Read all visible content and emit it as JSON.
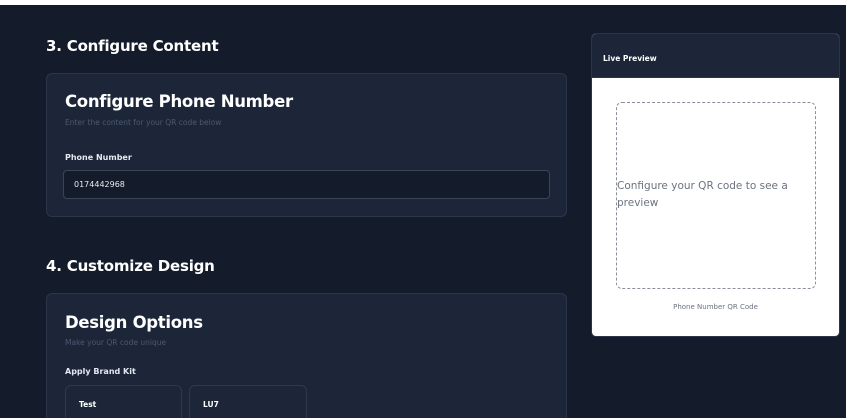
{
  "sections": {
    "content_title": "3. Configure Content",
    "design_title": "4. Customize Design"
  },
  "content_card": {
    "title": "Configure Phone Number",
    "subtitle": "Enter the content for your QR code below",
    "phone_label": "Phone Number",
    "phone_value": "0174442968"
  },
  "design_card": {
    "title": "Design Options",
    "subtitle": "Make your QR code unique",
    "brand_kit_label": "Apply Brand Kit",
    "brand_kits": [
      "Test",
      "LU7"
    ]
  },
  "preview": {
    "title": "Live Preview",
    "message": "Configure your QR code to see a preview",
    "caption": "Phone Number QR Code"
  },
  "colors": {
    "background": "#141c2c",
    "card": "#1c2638",
    "border": "#2b3549",
    "preview_bg": "#ffffff"
  }
}
